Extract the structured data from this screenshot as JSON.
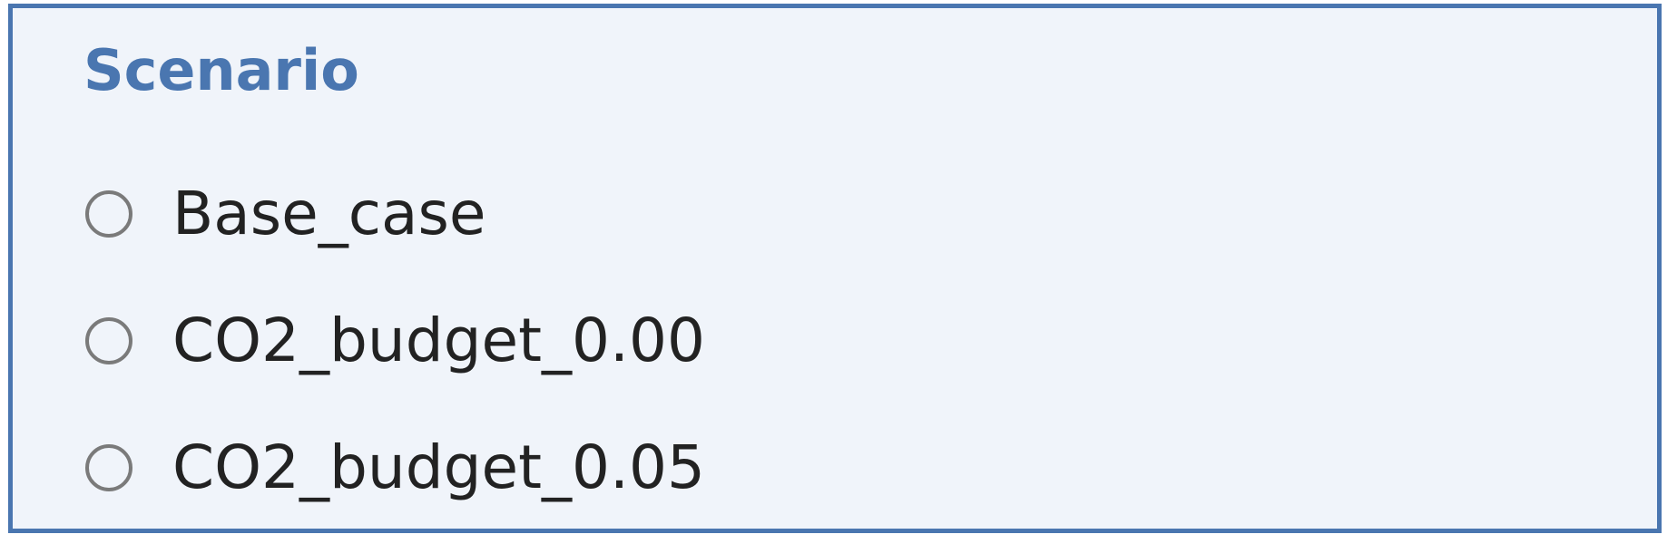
{
  "scenario_panel": {
    "title": "Scenario",
    "options": [
      {
        "label": "Base_case",
        "selected": false
      },
      {
        "label": "CO2_budget_0.00",
        "selected": false
      },
      {
        "label": "CO2_budget_0.05",
        "selected": false
      }
    ]
  },
  "colors": {
    "panel_background": "#f0f4fa",
    "panel_border": "#4a76b0",
    "title_text": "#4a76b0",
    "option_text": "#222222",
    "radio_border": "#7a7a7a"
  },
  "icons": {
    "radio_unselected": "radio-unchecked-icon"
  }
}
